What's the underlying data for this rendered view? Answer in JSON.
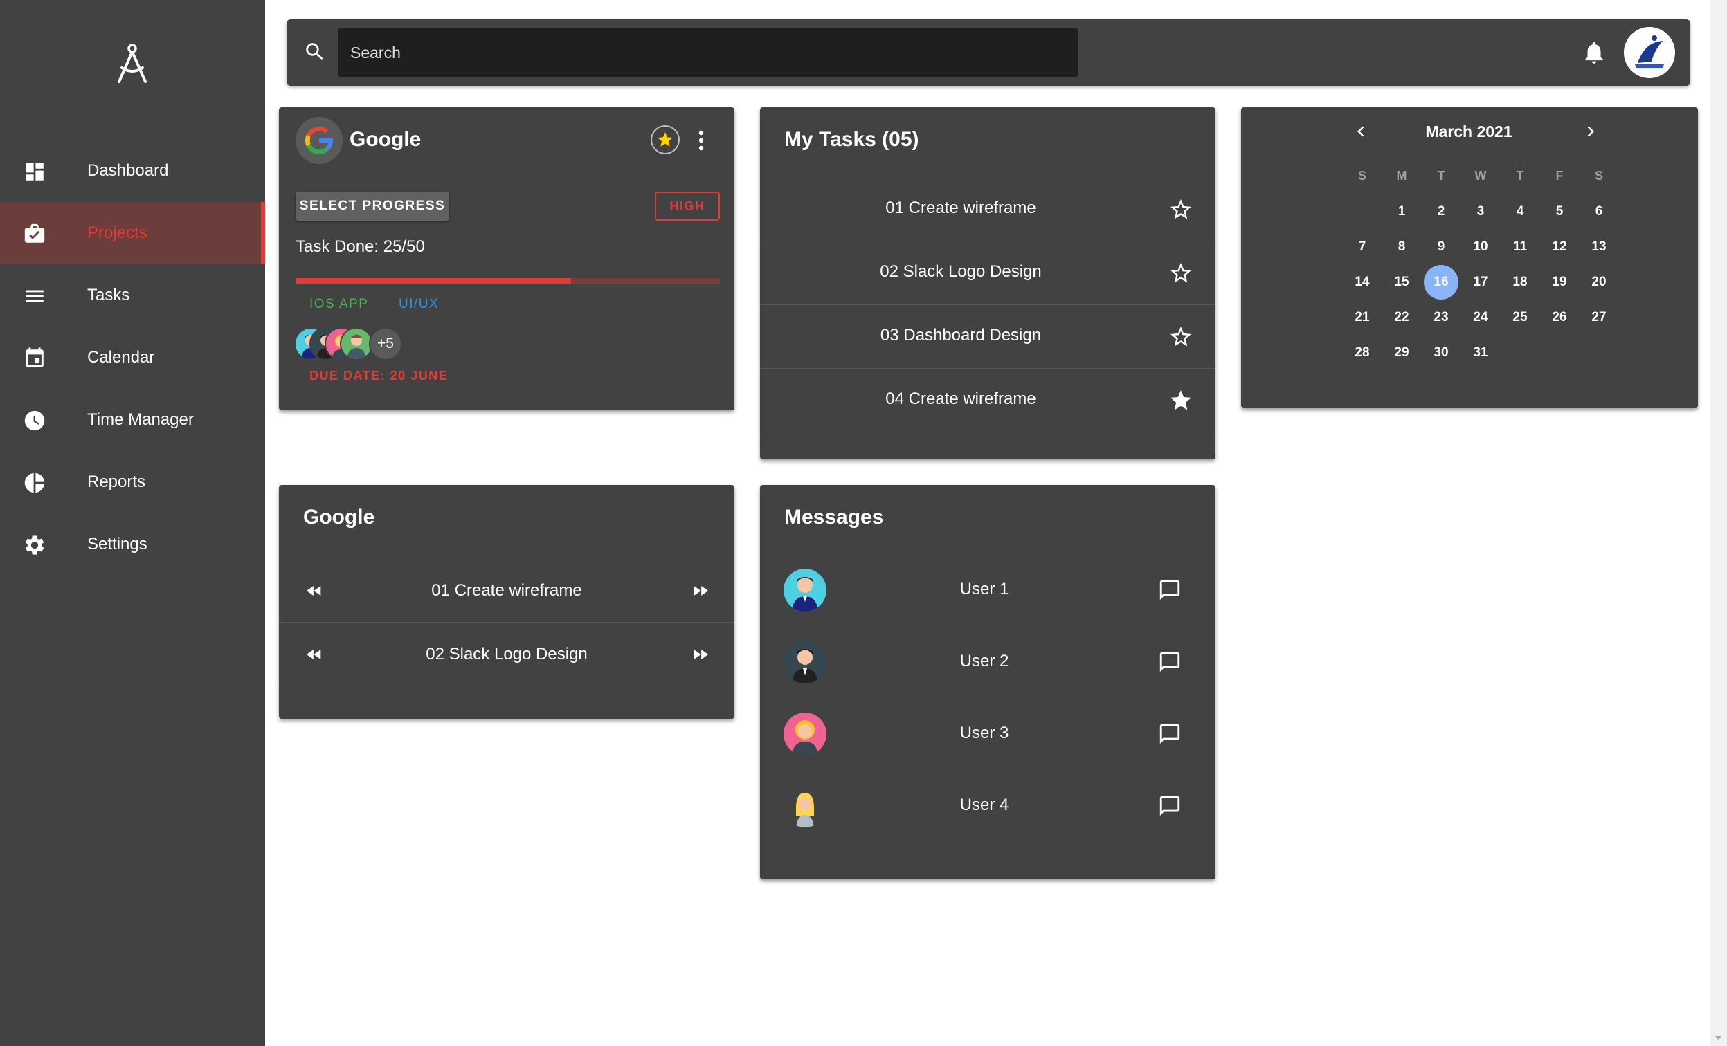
{
  "sidebar": {
    "items": [
      {
        "label": "Dashboard",
        "icon": "dashboard-icon"
      },
      {
        "label": "Projects",
        "icon": "briefcase-check-icon",
        "active": true
      },
      {
        "label": "Tasks",
        "icon": "menu-lines-icon"
      },
      {
        "label": "Calendar",
        "icon": "calendar-icon"
      },
      {
        "label": "Time Manager",
        "icon": "clock-icon"
      },
      {
        "label": "Reports",
        "icon": "pie-chart-icon"
      },
      {
        "label": "Settings",
        "icon": "gear-icon"
      }
    ],
    "active_color": "#e53935"
  },
  "topbar": {
    "search_placeholder": "Search"
  },
  "project_card": {
    "title": "Google",
    "select_progress_label": "SELECT PROGRESS",
    "priority": "HIGH",
    "task_done": "Task Done: 25/50",
    "progress_fraction": 0.65,
    "tags": [
      {
        "label": "IOS APP",
        "color": "#4caf50"
      },
      {
        "label": "UI/UX",
        "color": "#2196f3"
      }
    ],
    "extra_members": "+5",
    "due_date": "DUE DATE: 20 JUNE"
  },
  "my_tasks": {
    "title": "My Tasks (05)",
    "items": [
      {
        "label": "01 Create wireframe",
        "starred": false
      },
      {
        "label": "02 Slack Logo Design",
        "starred": false
      },
      {
        "label": "03 Dashboard Design",
        "starred": false
      },
      {
        "label": "04 Create wireframe",
        "starred": true
      }
    ]
  },
  "calendar": {
    "month": "March 2021",
    "weekdays": [
      "S",
      "M",
      "T",
      "W",
      "T",
      "F",
      "S"
    ],
    "first_weekday": 1,
    "days_in_month": 31,
    "today": 16,
    "today_color": "#8ab4f8"
  },
  "google_list": {
    "title": "Google",
    "items": [
      {
        "label": "01 Create wireframe"
      },
      {
        "label": "02 Slack Logo Design"
      }
    ]
  },
  "messages": {
    "title": "Messages",
    "users": [
      {
        "name": "User 1"
      },
      {
        "name": "User 2"
      },
      {
        "name": "User 3"
      },
      {
        "name": "User 4"
      }
    ]
  }
}
